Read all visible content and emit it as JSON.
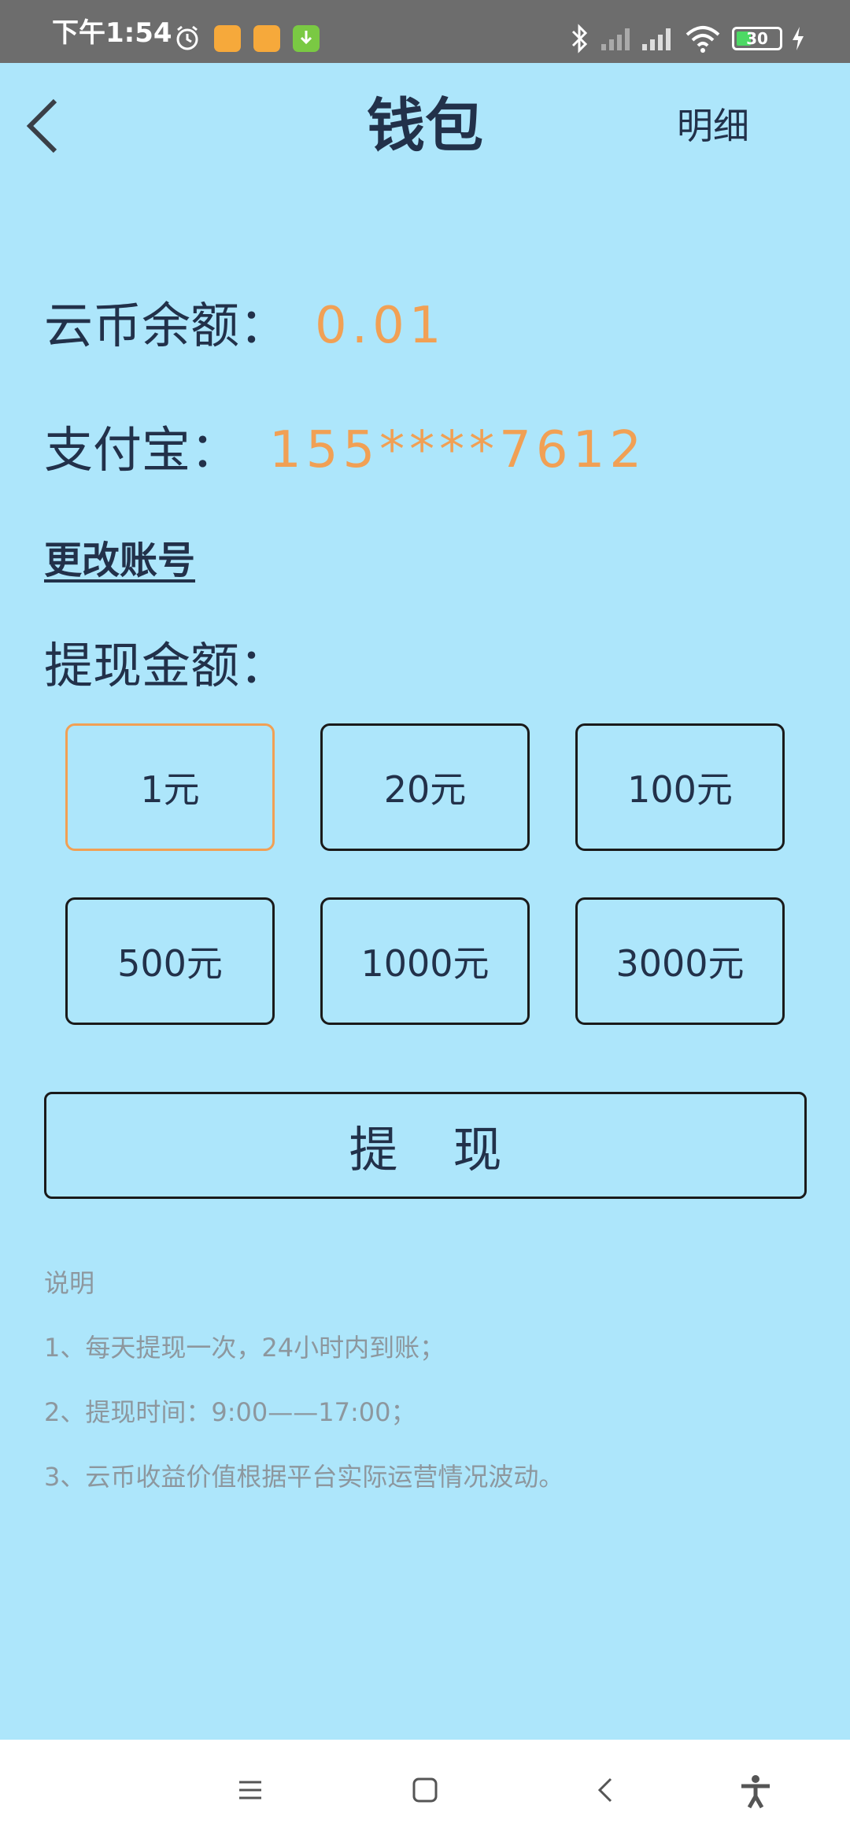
{
  "status_bar": {
    "time": "下午1:54",
    "battery": "30",
    "icons": [
      "alarm-icon",
      "notification-icon",
      "notification-icon",
      "download-icon",
      "bluetooth-icon",
      "signal-icon",
      "signal-icon",
      "wifi-icon",
      "battery-icon",
      "charging-icon"
    ]
  },
  "header": {
    "title": "钱包",
    "detail_label": "明细",
    "back_icon": "back-chevron-icon"
  },
  "wallet": {
    "balance_label": "云币余额：",
    "balance_value": "0.01",
    "alipay_label": "支付宝：",
    "alipay_value": "155****7612",
    "change_account_label": "更改账号",
    "amount_label": "提现金额：",
    "amounts": [
      "1元",
      "20元",
      "100元",
      "500元",
      "1000元",
      "3000元"
    ],
    "selected_amount": "1元",
    "withdraw_label": "提现"
  },
  "notes": {
    "title": "说明",
    "items": [
      "1、每天提现一次，24小时内到账；",
      "2、提现时间：9:00——17:00；",
      "3、云币收益价值根据平台实际运营情况波动。"
    ]
  },
  "colors": {
    "background": "#ade6fb",
    "accent": "#f1a054",
    "text": "#22314a",
    "note_text": "#8d979e",
    "status_bar": "#6d6d6d"
  },
  "nav_bar": {
    "icons": [
      "menu-icon",
      "home-icon",
      "back-icon",
      "accessibility-icon"
    ]
  }
}
